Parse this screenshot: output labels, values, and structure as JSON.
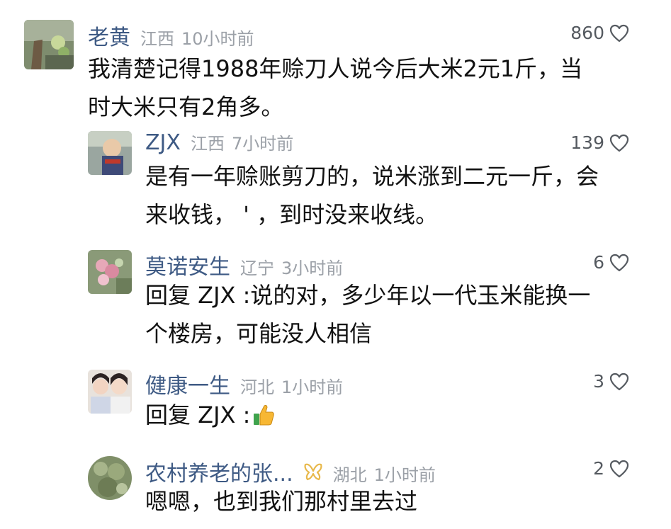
{
  "comments": [
    {
      "name": "老黄",
      "location": "江西",
      "time": "10小时前",
      "likes": "860",
      "text_lines": [
        "我清楚记得1988年赊刀人说今后大米2元1斤，当",
        "时大米只有2角多。"
      ]
    },
    {
      "name": "ZJX",
      "location": "江西",
      "time": "7小时前",
      "likes": "139",
      "text_lines": [
        "是有一年赊账剪刀的，说米涨到二元一斤，会",
        "来收钱，  '  ，到时没来收线。"
      ]
    },
    {
      "name": "莫诺安生",
      "location": "辽宁",
      "time": "3小时前",
      "likes": "6",
      "text_lines": [
        "回复 ZJX :说的对，多少年以一代玉米能换一",
        "个楼房，可能没人相信"
      ]
    },
    {
      "name": "健康一生",
      "location": "河北",
      "time": "1小时前",
      "likes": "3",
      "text_lines": [
        "回复 ZJX :"
      ],
      "emoji": "thumbs-up"
    },
    {
      "name": "农村养老的张...",
      "location": "湖北",
      "time": "1小时前",
      "likes": "2",
      "text_lines": [
        "嗯嗯，也到我们那村里去过"
      ],
      "badge": "gold-ribbon"
    }
  ],
  "colors": {
    "name": "#3e5a84",
    "meta": "#9ba0a7",
    "text": "#111111",
    "badge": "#e8b84a"
  }
}
